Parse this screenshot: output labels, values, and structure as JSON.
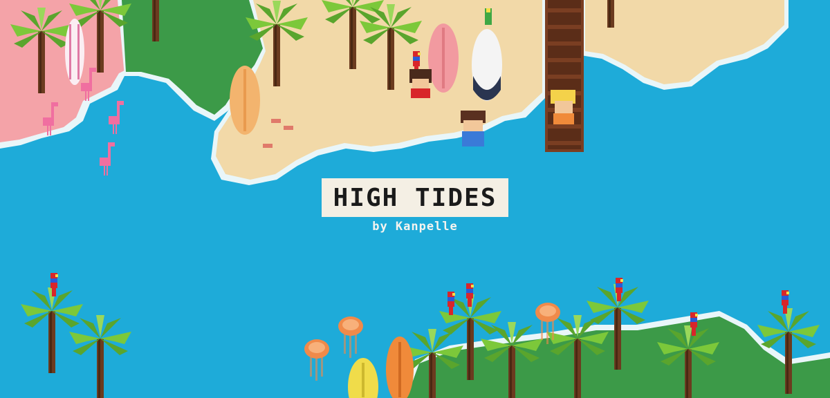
{
  "title": "HIGH TIDES",
  "byline": "by Kanpelle",
  "colors": {
    "water": "#1eabd9",
    "foam": "#e9f6f9",
    "sand": "#f2d9a8",
    "grass": "#3c9a48",
    "pink_sand": "#f4a3a8",
    "palm_leaf": "#7cc83a",
    "trunk": "#6b3b1f",
    "dock": "#7a3e22"
  },
  "icons": [
    "palm-tree-icon",
    "flamingo-icon",
    "parrot-icon",
    "surfboard-icon",
    "jellyfish-icon",
    "character-icon",
    "dock-icon"
  ]
}
